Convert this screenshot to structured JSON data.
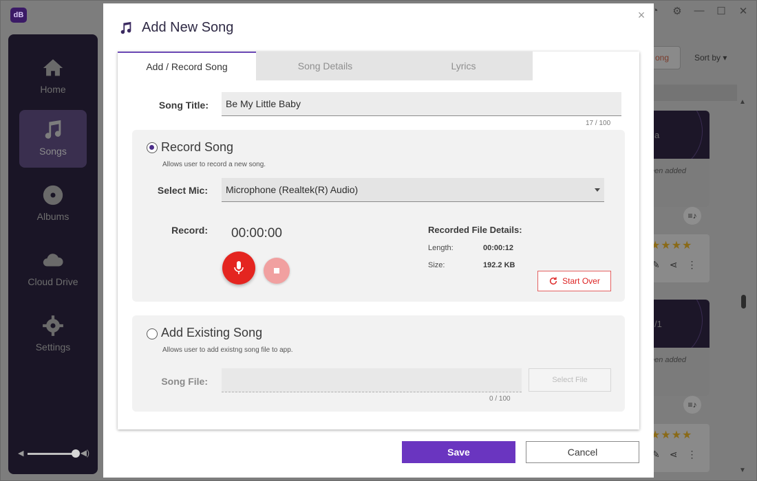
{
  "app": {
    "logo_text": "dB",
    "nav": [
      {
        "label": "Home",
        "icon": "home-icon"
      },
      {
        "label": "Songs",
        "icon": "music-note-icon"
      },
      {
        "label": "Albums",
        "icon": "disc-icon"
      },
      {
        "label": "Cloud Drive",
        "icon": "cloud-icon"
      },
      {
        "label": "Settings",
        "icon": "gear-icon"
      }
    ],
    "active_nav": "Songs",
    "toolbar": {
      "add_song_partial": "ong",
      "sort_by": "Sort by"
    },
    "cards": [
      {
        "art_text": "a",
        "added_text": "een added"
      },
      {
        "art_text": "/1",
        "added_text": "een added"
      }
    ],
    "rating_stars": "★★★★"
  },
  "modal": {
    "title": "Add New Song",
    "close_symbol": "×",
    "tabs": [
      {
        "label": "Add / Record Song",
        "active": true
      },
      {
        "label": "Song Details",
        "active": false
      },
      {
        "label": "Lyrics",
        "active": false
      }
    ],
    "song_title": {
      "label": "Song Title:",
      "value": "Be My Little Baby",
      "counter": "17 / 100"
    },
    "record_section": {
      "title": "Record Song",
      "description": "Allows user to record a new song.",
      "selected": true,
      "mic_label": "Select Mic:",
      "mic_value": "Microphone (Realtek(R) Audio)",
      "record_label": "Record:",
      "timer": "00:00:00",
      "details": {
        "title": "Recorded File Details:",
        "length_label": "Length:",
        "length_value": "00:00:12",
        "size_label": "Size:",
        "size_value": "192.2 KB"
      },
      "start_over_label": "Start Over"
    },
    "existing_section": {
      "title": "Add Existing Song",
      "description": "Allows user to add existng song file to app.",
      "selected": false,
      "file_label": "Song File:",
      "file_value": "",
      "counter": "0 / 100",
      "select_file_label": "Select File"
    },
    "save_label": "Save",
    "cancel_label": "Cancel"
  },
  "colors": {
    "accent": "#6a35c0",
    "record_red": "#e42520",
    "sidebar_bg": "#1a1526"
  }
}
